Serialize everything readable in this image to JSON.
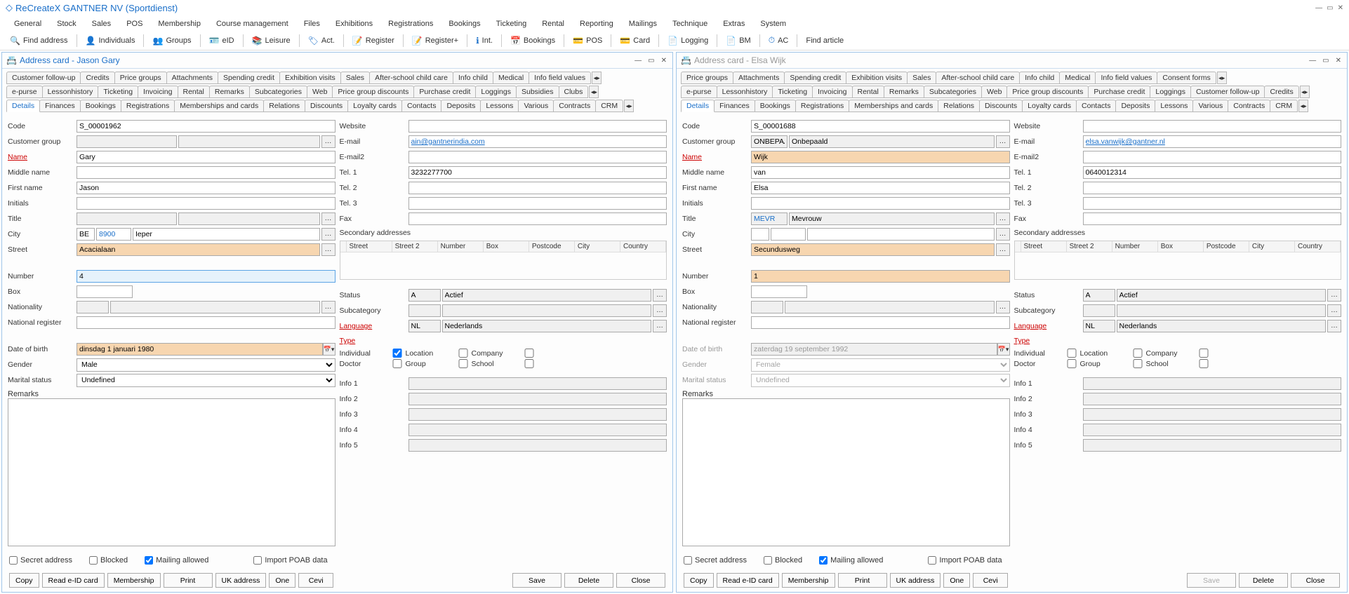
{
  "app_title": "ReCreateX GANTNER NV  (Sportdienst)",
  "main_menu": [
    "General",
    "Stock",
    "Sales",
    "POS",
    "Membership",
    "Course management",
    "Files",
    "Exhibitions",
    "Registrations",
    "Bookings",
    "Ticketing",
    "Rental",
    "Reporting",
    "Mailings",
    "Technique",
    "Extras",
    "System"
  ],
  "toolbar": [
    {
      "icon": "🔍",
      "label": "Find address"
    },
    {
      "icon": "👤",
      "label": "Individuals"
    },
    {
      "icon": "👥",
      "label": "Groups"
    },
    {
      "icon": "🪪",
      "label": "eID"
    },
    {
      "icon": "📚",
      "label": "Leisure"
    },
    {
      "icon": "🏷",
      "label": "Act."
    },
    {
      "icon": "📝",
      "label": "Register"
    },
    {
      "icon": "📝",
      "label": "Register+"
    },
    {
      "icon": "ℹ",
      "label": "Int."
    },
    {
      "icon": "📅",
      "label": "Bookings"
    },
    {
      "icon": "💳",
      "label": "POS"
    },
    {
      "icon": "💳",
      "label": "Card"
    },
    {
      "icon": "📄",
      "label": "Logging"
    },
    {
      "icon": "📄",
      "label": "BM"
    },
    {
      "icon": "⏱",
      "label": "AC"
    },
    {
      "label": "Find article"
    }
  ],
  "tab_rows_left": [
    [
      "Customer follow-up",
      "Credits",
      "Price groups",
      "Attachments",
      "Spending credit",
      "Exhibition visits",
      "Sales",
      "After-school child care",
      "Info child",
      "Medical",
      "Info field values"
    ],
    [
      "e-purse",
      "Lessonhistory",
      "Ticketing",
      "Invoicing",
      "Rental",
      "Remarks",
      "Subcategories",
      "Web",
      "Price group discounts",
      "Purchase credit",
      "Loggings",
      "Subsidies",
      "Clubs"
    ],
    [
      "Details",
      "Finances",
      "Bookings",
      "Registrations",
      "Memberships and cards",
      "Relations",
      "Discounts",
      "Loyalty cards",
      "Contacts",
      "Deposits",
      "Lessons",
      "Various",
      "Contracts",
      "CRM"
    ]
  ],
  "tab_rows_right": [
    [
      "Price groups",
      "Attachments",
      "Spending credit",
      "Exhibition visits",
      "Sales",
      "After-school child care",
      "Info child",
      "Medical",
      "Info field values",
      "Consent forms"
    ],
    [
      "e-purse",
      "Lessonhistory",
      "Ticketing",
      "Invoicing",
      "Rental",
      "Remarks",
      "Subcategories",
      "Web",
      "Price group discounts",
      "Purchase credit",
      "Loggings",
      "Customer follow-up",
      "Credits"
    ],
    [
      "Details",
      "Finances",
      "Bookings",
      "Registrations",
      "Memberships and cards",
      "Relations",
      "Discounts",
      "Loyalty cards",
      "Contacts",
      "Deposits",
      "Lessons",
      "Various",
      "Contracts",
      "CRM"
    ]
  ],
  "labels": {
    "code": "Code",
    "customer_group": "Customer group",
    "name": "Name",
    "middle_name": "Middle name",
    "first_name": "First name",
    "initials": "Initials",
    "title": "Title",
    "city": "City",
    "street": "Street",
    "number": "Number",
    "box": "Box",
    "nationality": "Nationality",
    "national_register": "National register",
    "dob": "Date of birth",
    "gender": "Gender",
    "marital_status": "Marital status",
    "remarks": "Remarks",
    "website": "Website",
    "email": "E-mail",
    "email2": "E-mail2",
    "tel1": "Tel. 1",
    "tel2": "Tel. 2",
    "tel3": "Tel. 3",
    "fax": "Fax",
    "sec_addr": "Secondary addresses",
    "status": "Status",
    "subcategory": "Subcategory",
    "language": "Language",
    "type": "Type",
    "individual": "Individual",
    "doctor": "Doctor",
    "location": "Location",
    "group": "Group",
    "company": "Company",
    "school": "School",
    "info1": "Info 1",
    "info2": "Info 2",
    "info3": "Info 3",
    "info4": "Info 4",
    "info5": "Info 5",
    "secret": "Secret address",
    "blocked": "Blocked",
    "mailing": "Mailing allowed",
    "import_poab": "Import POAB data"
  },
  "sec_addr_headers": [
    "",
    "Street",
    "Street 2",
    "Number",
    "Box",
    "Postcode",
    "City",
    "Country"
  ],
  "buttons": {
    "copy": "Copy",
    "read_eid": "Read e-ID card",
    "membership": "Membership",
    "print": "Print",
    "uk": "UK address",
    "one": "One",
    "cevi": "Cevi",
    "save": "Save",
    "delete": "Delete",
    "close": "Close"
  },
  "left": {
    "header": "Address card - Jason Gary",
    "code": "S_00001962",
    "customer_group": "",
    "name": "Gary",
    "middle_name": "",
    "first_name": "Jason",
    "initials": "",
    "title": "",
    "city_cc": "BE",
    "city_pc": "8900",
    "city_name": "Ieper",
    "street": "Acacialaan",
    "number": "4",
    "box": "",
    "nationality": "",
    "national_register": "",
    "dob": "dinsdag 1 januari 1980",
    "gender": "Male",
    "marital": "Undefined",
    "remarks": "",
    "website": "",
    "email": "ain@gantnerindia.com",
    "email2": "",
    "tel1": "3232277700",
    "tel2": "",
    "tel3": "",
    "fax": "",
    "status_code": "A",
    "status_text": "Actief",
    "subcategory": "",
    "lang_code": "NL",
    "lang_text": "Nederlands",
    "individual": true,
    "mailing_allowed": true
  },
  "right": {
    "header": "Address card - Elsa Wijk",
    "code": "S_00001688",
    "customer_group_code": "ONBEPAAL",
    "customer_group_text": "Onbepaald",
    "name": "Wijk",
    "middle_name": "van",
    "first_name": "Elsa",
    "initials": "",
    "title_code": "MEVR",
    "title_text": "Mevrouw",
    "city_cc": "",
    "city_pc": "",
    "city_name": "",
    "street": "Secundusweg",
    "number": "1",
    "box": "",
    "nationality": "",
    "national_register": "",
    "dob": "zaterdag 19 september 1992",
    "gender": "Female",
    "marital": "Undefined",
    "remarks": "",
    "website": "",
    "email": "elsa.vanwijk@gantner.nl",
    "email2": "",
    "tel1": "0640012314",
    "tel2": "",
    "tel3": "",
    "fax": "",
    "status_code": "A",
    "status_text": "Actief",
    "subcategory": "",
    "lang_code": "NL",
    "lang_text": "Nederlands",
    "individual": false,
    "mailing_allowed": true
  }
}
